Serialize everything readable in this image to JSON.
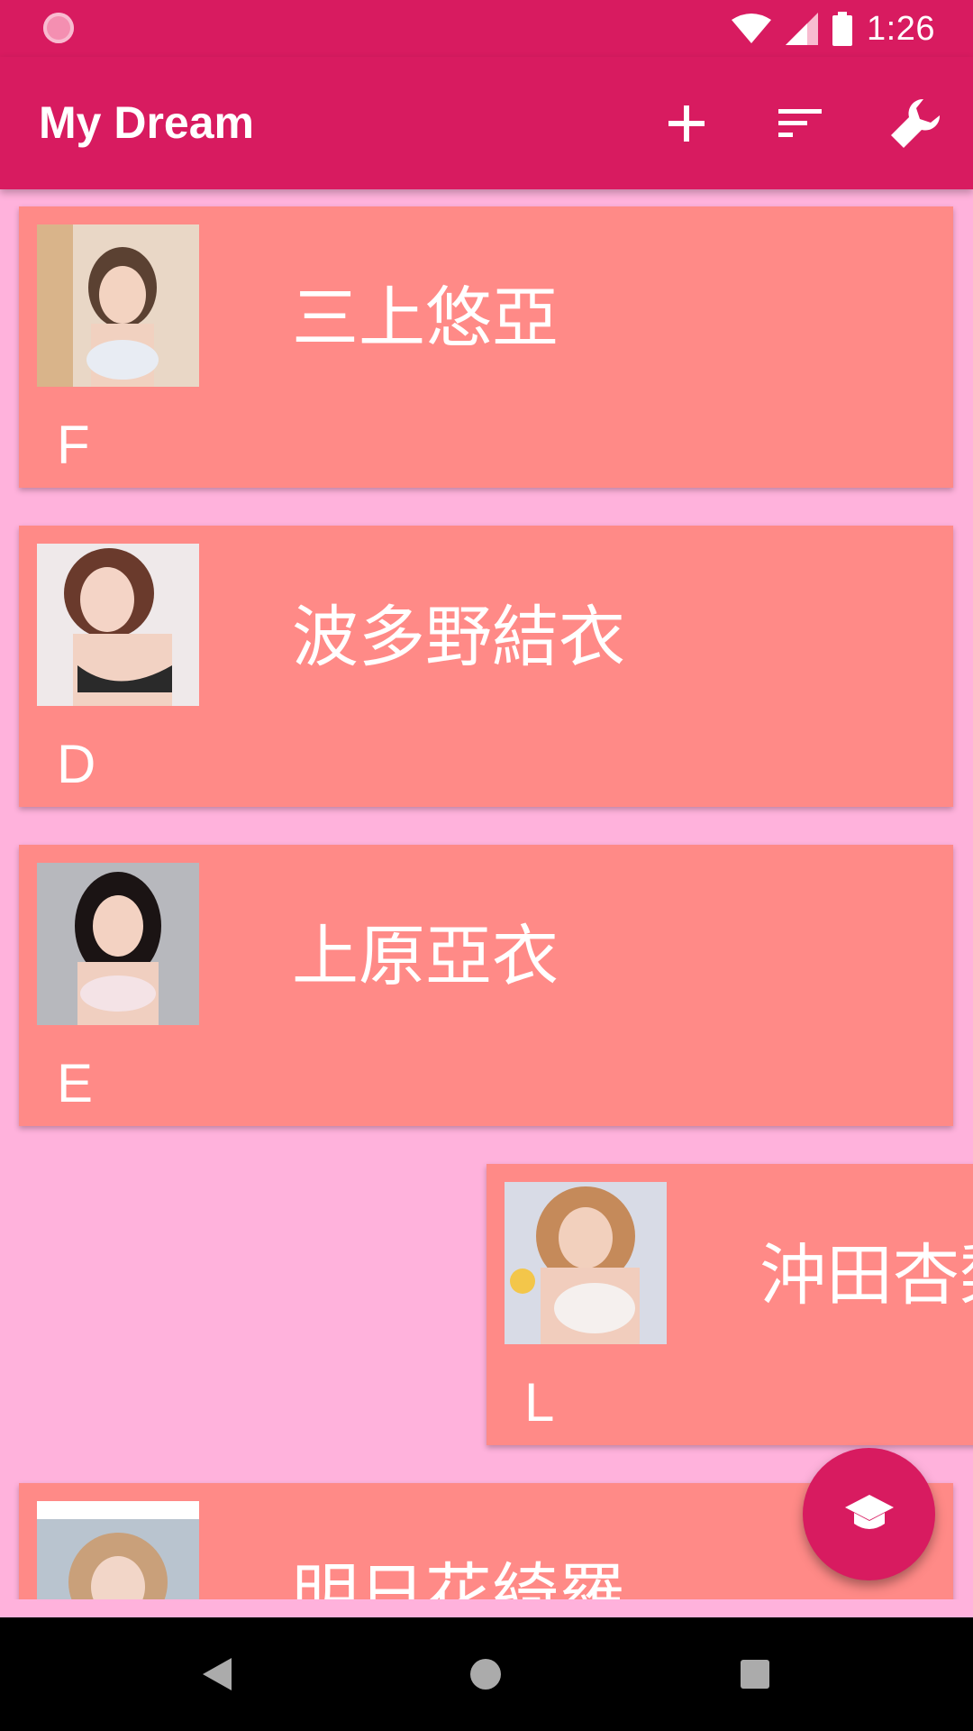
{
  "status_bar": {
    "time": "1:26"
  },
  "app_bar": {
    "title": "My Dream",
    "actions": [
      {
        "name": "add",
        "icon": "plus-icon"
      },
      {
        "name": "sort",
        "icon": "sort-icon"
      },
      {
        "name": "settings",
        "icon": "wrench-icon"
      }
    ]
  },
  "list": {
    "items": [
      {
        "name": "三上悠亞",
        "grade": "F",
        "thumbnail": "photo"
      },
      {
        "name": "波多野結衣",
        "grade": "D",
        "thumbnail": "photo"
      },
      {
        "name": "上原亞衣",
        "grade": "E",
        "thumbnail": "photo"
      },
      {
        "name": "沖田杏梨",
        "grade": "L",
        "thumbnail": "photo"
      },
      {
        "name": "明日花綺羅",
        "grade": "",
        "thumbnail": "photo"
      }
    ]
  },
  "fab": {
    "icon": "graduation-cap-icon"
  },
  "colors": {
    "primary": "#d81b60",
    "background": "#ffb2dc",
    "card": "#ff8a87",
    "text_on_primary": "#ffffff"
  }
}
